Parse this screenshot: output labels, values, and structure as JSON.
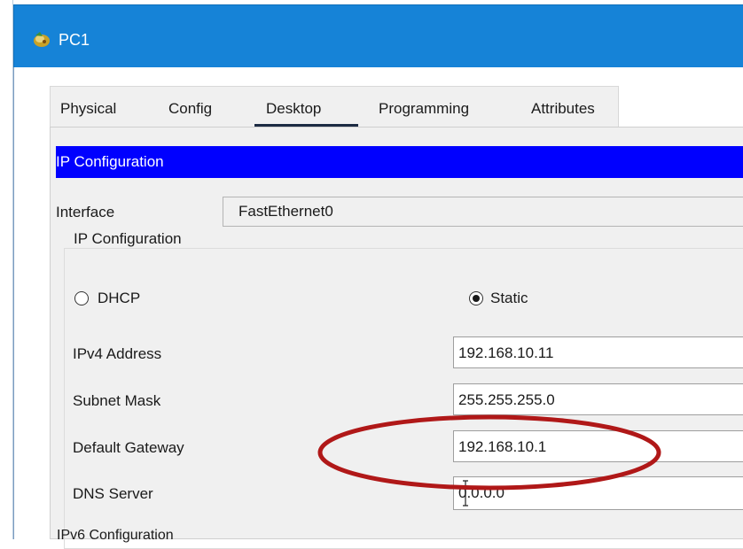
{
  "window": {
    "title": "PC1",
    "colors": {
      "titlebar": "#1683d7",
      "header": "#0000ff",
      "annotation": "#b01818"
    }
  },
  "tabs": [
    {
      "label": "Physical"
    },
    {
      "label": "Config"
    },
    {
      "label": "Desktop",
      "active": true
    },
    {
      "label": "Programming"
    },
    {
      "label": "Attributes"
    }
  ],
  "ipconfig": {
    "header": "IP Configuration",
    "interface_label": "Interface",
    "interface_value": "FastEthernet0",
    "group_title": "IP Configuration",
    "dhcp_label": "DHCP",
    "static_label": "Static",
    "selected_mode": "Static",
    "ipv4_label": "IPv4 Address",
    "ipv4_value": "192.168.10.11",
    "mask_label": "Subnet Mask",
    "mask_value": "255.255.255.0",
    "gateway_label": "Default Gateway",
    "gateway_value": "192.168.10.1",
    "dns_label": "DNS Server",
    "dns_value": "0.0.0.0",
    "next_section_partial": "IPv6 Configuration"
  }
}
